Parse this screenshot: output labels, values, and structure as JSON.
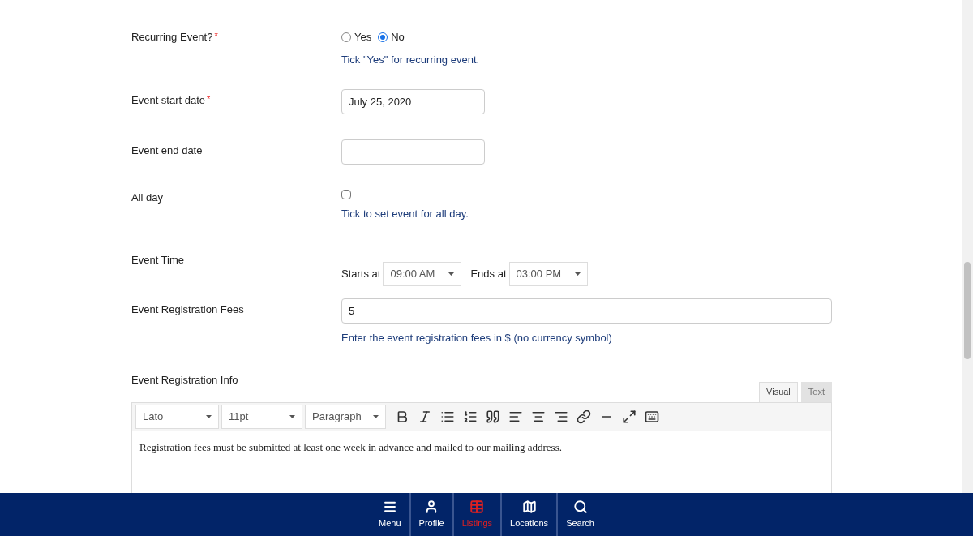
{
  "fields": [
    {
      "kind": "radio",
      "label": "Recurring Event?",
      "required_mark": "*",
      "options": [
        {
          "label": "Yes",
          "selected": false
        },
        {
          "label": "No",
          "selected": true
        }
      ],
      "hint": "Tick \"Yes\" for recurring event."
    },
    {
      "kind": "date",
      "label": "Event start date",
      "required_mark": "*",
      "value": "July 25, 2020"
    },
    {
      "kind": "date",
      "label": "Event end date"
    },
    {
      "kind": "checkbox",
      "label": "All day",
      "checked": false,
      "hint": "Tick to set event for all day."
    },
    {
      "kind": "time",
      "label": "Event Time",
      "start_label": "Starts at",
      "start_value": "09:00 AM",
      "end_label": "Ends at",
      "end_value": "03:00 PM"
    },
    {
      "kind": "text",
      "label": "Event Registration Fees",
      "value": "5",
      "hint": "Enter the event registration fees in $ (no currency symbol)"
    },
    {
      "kind": "editor",
      "label": "Event Registration Info",
      "tabs": [
        {
          "label": "Visual",
          "selected": true
        },
        {
          "label": "Text",
          "selected": false
        }
      ],
      "font": "Lato",
      "size": "11pt",
      "format": "Paragraph",
      "content": "Registration fees must be submitted at least one week in advance and mailed to our mailing address."
    }
  ],
  "bottom_nav": [
    {
      "label": "Menu",
      "selected": false
    },
    {
      "label": "Profile",
      "selected": false
    },
    {
      "label": "Listings",
      "selected": true
    },
    {
      "label": "Locations",
      "selected": false
    },
    {
      "label": "Search",
      "selected": false
    }
  ]
}
